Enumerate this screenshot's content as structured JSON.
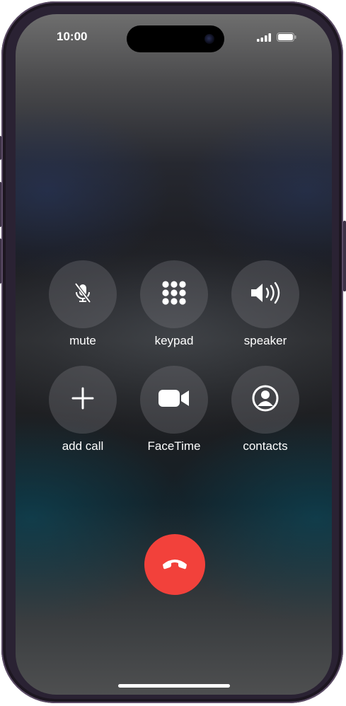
{
  "status_bar": {
    "time": "10:00",
    "signal_icon": "cellular-signal-icon",
    "battery_icon": "battery-icon"
  },
  "call_controls": [
    {
      "id": "mute",
      "label": "mute",
      "icon": "mic-slash-icon"
    },
    {
      "id": "keypad",
      "label": "keypad",
      "icon": "keypad-grid-icon"
    },
    {
      "id": "speaker",
      "label": "speaker",
      "icon": "speaker-wave-icon"
    },
    {
      "id": "add-call",
      "label": "add call",
      "icon": "plus-icon"
    },
    {
      "id": "facetime",
      "label": "FaceTime",
      "icon": "video-camera-icon"
    },
    {
      "id": "contacts",
      "label": "contacts",
      "icon": "person-circle-icon"
    }
  ],
  "end_call": {
    "icon": "phone-down-icon",
    "color": "#F2413B"
  },
  "colors": {
    "end_call_red": "#F2413B",
    "control_fill": "rgba(120,120,125,0.35)",
    "text": "#FFFFFF"
  }
}
